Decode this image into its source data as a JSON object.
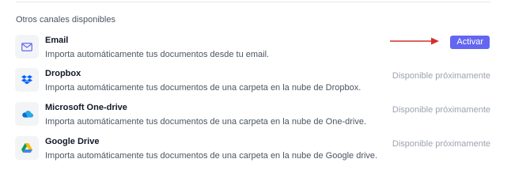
{
  "section_title": "Otros canales disponibles",
  "colors": {
    "accent": "#6366f1",
    "arrow": "#d32f2f"
  },
  "channels": [
    {
      "name": "Email",
      "description": "Importa automáticamente tus documentos desde tu email.",
      "action_label": "Activar",
      "icon": "envelope-icon"
    },
    {
      "name": "Dropbox",
      "description": "Importa automáticamente tus documentos de una carpeta en la nube de Dropbox.",
      "status": "Disponible próximamente",
      "icon": "dropbox-icon"
    },
    {
      "name": "Microsoft One-drive",
      "description": "Importa automáticamente tus documentos de una carpeta en la nube de One-drive.",
      "status": "Disponible próximamente",
      "icon": "onedrive-icon"
    },
    {
      "name": "Google Drive",
      "description": "Importa automáticamente tus documentos de una carpeta en la nube de Google drive.",
      "status": "Disponible próximamente",
      "icon": "google-drive-icon"
    }
  ]
}
